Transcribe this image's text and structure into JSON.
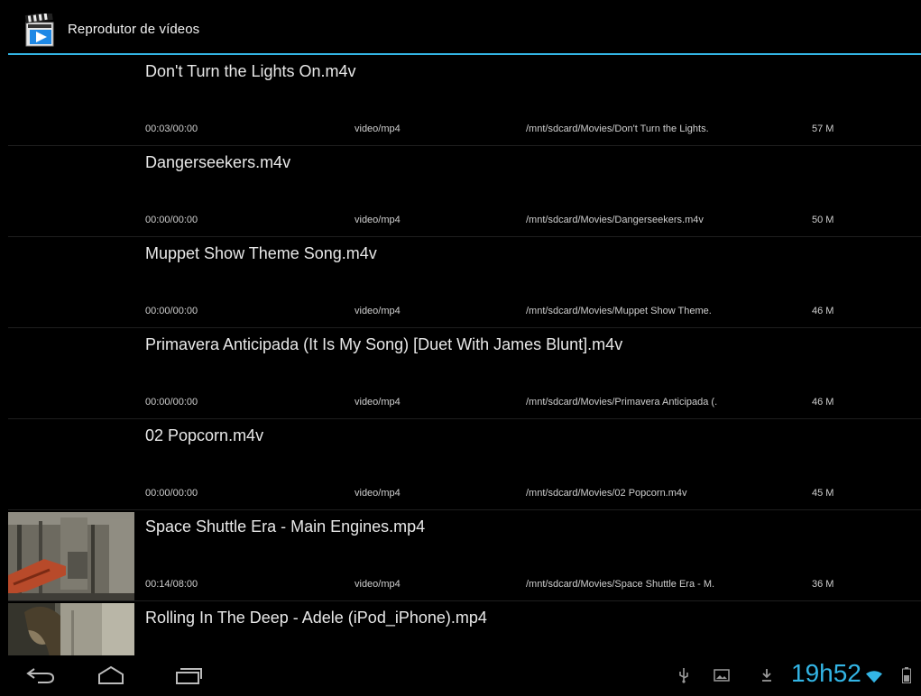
{
  "app": {
    "title": "Reprodutor de vídeos",
    "icon": "clapperboard-play-icon",
    "accent_color": "#33b5e5"
  },
  "videos": [
    {
      "title": "Don't Turn the Lights On.m4v",
      "position": "00:03/00:00",
      "mime": "video/mp4",
      "path": "/mnt/sdcard/Movies/Don't Turn the Lights.",
      "size": "57 M",
      "thumbnail": "none"
    },
    {
      "title": "Dangerseekers.m4v",
      "position": "00:00/00:00",
      "mime": "video/mp4",
      "path": "/mnt/sdcard/Movies/Dangerseekers.m4v",
      "size": "50 M",
      "thumbnail": "none"
    },
    {
      "title": "Muppet Show Theme Song.m4v",
      "position": "00:00/00:00",
      "mime": "video/mp4",
      "path": "/mnt/sdcard/Movies/Muppet Show Theme.",
      "size": "46 M",
      "thumbnail": "none"
    },
    {
      "title": "Primavera Anticipada (It Is My Song) [Duet With James Blunt].m4v",
      "position": "00:00/00:00",
      "mime": "video/mp4",
      "path": "/mnt/sdcard/Movies/Primavera Anticipada (.",
      "size": "46 M",
      "thumbnail": "none"
    },
    {
      "title": "02 Popcorn.m4v",
      "position": "00:00/00:00",
      "mime": "video/mp4",
      "path": "/mnt/sdcard/Movies/02 Popcorn.m4v",
      "size": "45 M",
      "thumbnail": "none"
    },
    {
      "title": "Space Shuttle Era - Main Engines.mp4",
      "position": "00:14/08:00",
      "mime": "video/mp4",
      "path": "/mnt/sdcard/Movies/Space Shuttle Era - M.",
      "size": "36 M",
      "thumbnail": "shuttle-engine-frame"
    },
    {
      "title": "Rolling In The Deep - Adele (iPod_iPhone).mp4",
      "position": "",
      "mime": "",
      "path": "",
      "size": "",
      "thumbnail": "adele-frame"
    }
  ],
  "navbar": {
    "buttons": [
      "back-icon",
      "home-icon",
      "recent-apps-icon"
    ],
    "status_icons": [
      "usb-icon",
      "gallery-notification-icon",
      "download-icon",
      "wifi-icon",
      "battery-icon"
    ],
    "clock": "19h52"
  }
}
